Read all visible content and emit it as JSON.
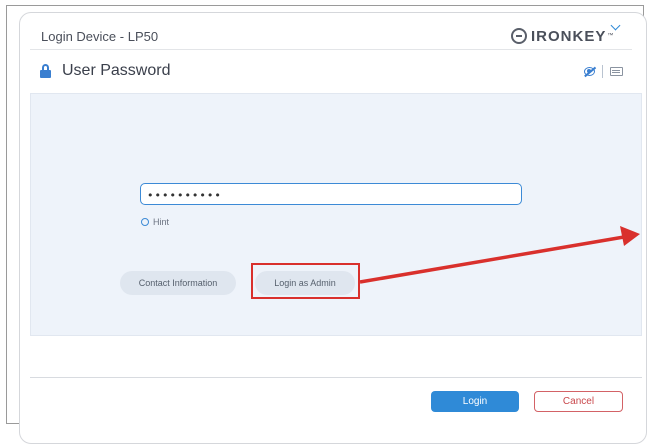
{
  "window": {
    "title": "Login Device - LP50",
    "brand": "IRONKEY",
    "brand_tm": "™"
  },
  "header": {
    "title": "User Password"
  },
  "password": {
    "value": "••••••••••",
    "hint_label": "Hint"
  },
  "actions": {
    "contact_label": "Contact Information",
    "admin_label": "Login as Admin"
  },
  "footer": {
    "login_label": "Login",
    "cancel_label": "Cancel"
  },
  "colors": {
    "accent": "#2f8ad7",
    "annotation": "#d9302c",
    "cancel": "#c9484c",
    "panel": "#eef3fa"
  }
}
